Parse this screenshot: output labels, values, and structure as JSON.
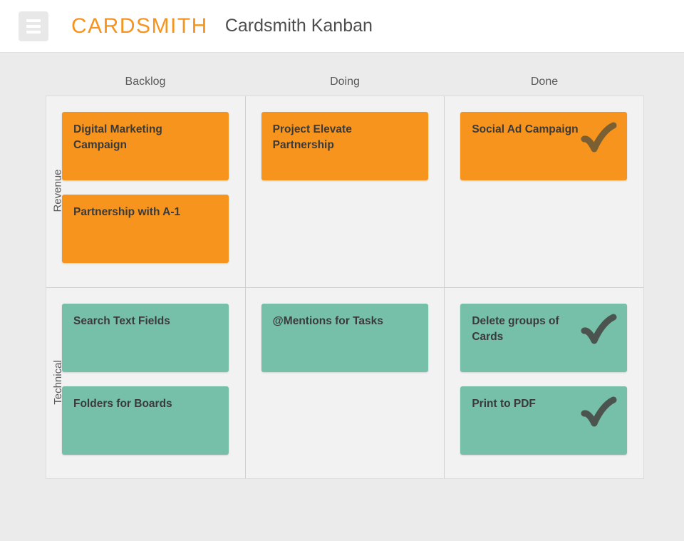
{
  "header": {
    "menu_icon": "hamburger-menu-icon",
    "brand": "CARDSMITH",
    "board_title": "Cardsmith Kanban"
  },
  "colors": {
    "brand_orange": "#f5941f",
    "card_orange": "#f7941e",
    "card_green": "#76bfa8",
    "page_background": "#ebebeb",
    "grid_background": "#f2f2f2",
    "card_text": "#3a3a3a",
    "check_orange_card": "#7a5f32",
    "check_green_card": "#4c5450"
  },
  "board": {
    "columns": [
      "Backlog",
      "Doing",
      "Done"
    ],
    "rows": [
      {
        "label": "Revenue",
        "color": "orange",
        "cells": [
          {
            "column": "Backlog",
            "cards": [
              {
                "title": "Digital Marketing Campaign",
                "done": false
              },
              {
                "title": "Partnership with A-1",
                "done": false
              }
            ]
          },
          {
            "column": "Doing",
            "cards": [
              {
                "title": "Project Elevate Partnership",
                "done": false
              }
            ]
          },
          {
            "column": "Done",
            "cards": [
              {
                "title": "Social Ad Campaign",
                "done": true
              }
            ]
          }
        ]
      },
      {
        "label": "Technical",
        "color": "green",
        "cells": [
          {
            "column": "Backlog",
            "cards": [
              {
                "title": "Search Text Fields",
                "done": false
              },
              {
                "title": "Folders for Boards",
                "done": false
              }
            ]
          },
          {
            "column": "Doing",
            "cards": [
              {
                "title": "@Mentions for Tasks",
                "done": false
              }
            ]
          },
          {
            "column": "Done",
            "cards": [
              {
                "title": "Delete groups of Cards",
                "done": true
              },
              {
                "title": "Print to PDF",
                "done": true
              }
            ]
          }
        ]
      }
    ]
  }
}
